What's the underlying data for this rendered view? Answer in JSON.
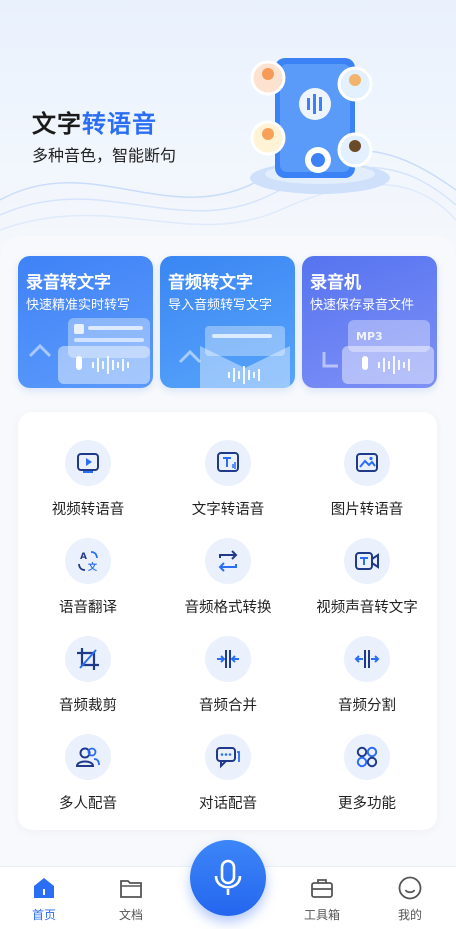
{
  "hero": {
    "title_plain": "文字",
    "title_accent": "转语音",
    "subtitle": "多种音色，智能断句"
  },
  "features": [
    {
      "title": "录音转文字",
      "subtitle": "快速精准实时转写"
    },
    {
      "title": "音频转文字",
      "subtitle": "导入音频转写文字"
    },
    {
      "title": "录音机",
      "subtitle": "快速保存录音文件",
      "badge": "MP3"
    }
  ],
  "tools": [
    {
      "label": "视频转语音",
      "icon": "video-play-icon"
    },
    {
      "label": "文字转语音",
      "icon": "text-sound-icon"
    },
    {
      "label": "图片转语音",
      "icon": "image-icon"
    },
    {
      "label": "语音翻译",
      "icon": "translate-icon"
    },
    {
      "label": "音频格式转换",
      "icon": "convert-icon"
    },
    {
      "label": "视频声音转文字",
      "icon": "video-text-icon"
    },
    {
      "label": "音频裁剪",
      "icon": "crop-icon"
    },
    {
      "label": "音频合并",
      "icon": "merge-icon"
    },
    {
      "label": "音频分割",
      "icon": "split-icon"
    },
    {
      "label": "多人配音",
      "icon": "people-icon"
    },
    {
      "label": "对话配音",
      "icon": "chat-icon"
    },
    {
      "label": "更多功能",
      "icon": "grid-icon"
    }
  ],
  "tabbar": {
    "home": "首页",
    "docs": "文档",
    "toolbox": "工具箱",
    "mine": "我的"
  },
  "colors": {
    "accent": "#2a6ef5",
    "icon_bg": "#eaf1fd"
  }
}
